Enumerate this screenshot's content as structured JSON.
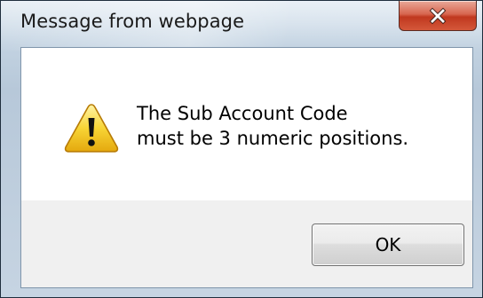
{
  "window": {
    "title": "Message from webpage"
  },
  "dialog": {
    "message_lines": [
      "The Sub Account Code",
      "must be 3 numeric positions."
    ],
    "icon": "warning-icon"
  },
  "buttons": {
    "ok_label": "OK",
    "close_icon": "close-icon"
  },
  "colors": {
    "close_button": "#c7452b",
    "warning_yellow": "#f6d02f",
    "footer_bg": "#f0f0f0"
  }
}
